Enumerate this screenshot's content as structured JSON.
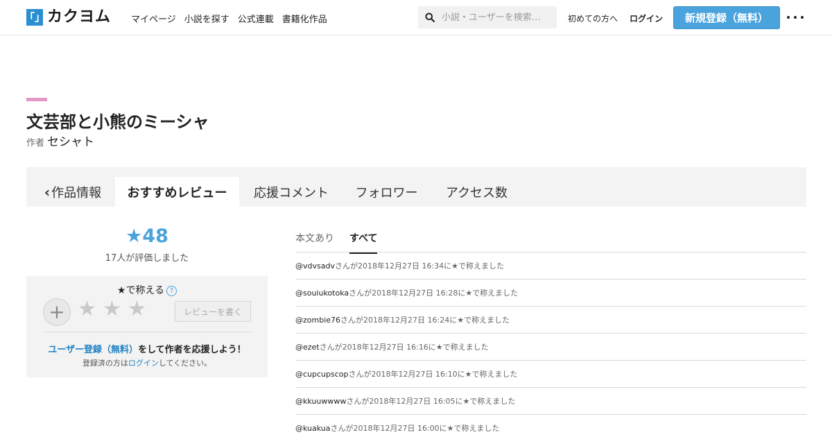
{
  "header": {
    "logo_mark": "「」",
    "logo_text": "カクヨム",
    "nav": [
      "マイページ",
      "小説を探す",
      "公式連載",
      "書籍化作品"
    ],
    "search_placeholder": "小説・ユーザーを検索…",
    "first_time": "初めての方へ",
    "login": "ログイン",
    "signup": "新規登録（無料）"
  },
  "work": {
    "title": "文芸部と小熊のミーシャ",
    "author_label": "作者",
    "author": "セシャト"
  },
  "tabs": {
    "back": "作品情報",
    "items": [
      "おすすめレビュー",
      "応援コメント",
      "フォロワー",
      "アクセス数"
    ]
  },
  "rating": {
    "score": "★48",
    "raters": "17人が評価しました"
  },
  "praise": {
    "title": "★で称える",
    "help": "?",
    "plus": "+",
    "star": "★",
    "write_review": "レビューを書く",
    "cta_link": "ユーザー登録（無料）",
    "cta_rest": "をして作者を応援しよう！",
    "sub_prefix": "登録済の方は",
    "sub_link": "ログイン",
    "sub_suffix": "してください。"
  },
  "subtabs": [
    "本文あり",
    "すべて"
  ],
  "reviews": [
    {
      "user": "@vdvsadv",
      "text": "さんが2018年12月27日 16:34に★で称えました"
    },
    {
      "user": "@souiukotoka",
      "text": "さんが2018年12月27日 16:28に★で称えました"
    },
    {
      "user": "@zombie76",
      "text": "さんが2018年12月27日 16:24に★で称えました"
    },
    {
      "user": "@ezet",
      "text": "さんが2018年12月27日 16:16に★で称えました"
    },
    {
      "user": "@cupcupscop",
      "text": "さんが2018年12月27日 16:10に★で称えました"
    },
    {
      "user": "@kkuuwwww",
      "text": "さんが2018年12月27日 16:05に★で称えました"
    },
    {
      "user": "@kuakua",
      "text": "さんが2018年12月27日 16:00に★で称えました"
    }
  ]
}
